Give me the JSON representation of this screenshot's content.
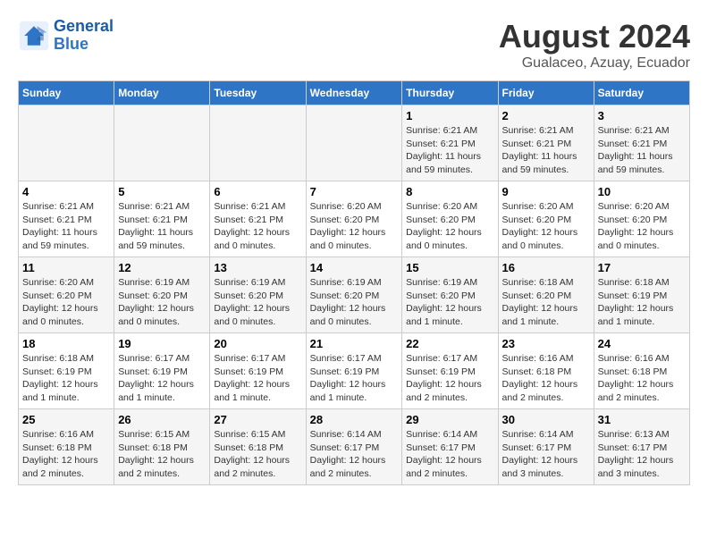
{
  "logo": {
    "line1": "General",
    "line2": "Blue"
  },
  "title": {
    "month_year": "August 2024",
    "location": "Gualaceo, Azuay, Ecuador"
  },
  "weekdays": [
    "Sunday",
    "Monday",
    "Tuesday",
    "Wednesday",
    "Thursday",
    "Friday",
    "Saturday"
  ],
  "weeks": [
    [
      {
        "day": "",
        "sunrise": "",
        "sunset": "",
        "daylight": ""
      },
      {
        "day": "",
        "sunrise": "",
        "sunset": "",
        "daylight": ""
      },
      {
        "day": "",
        "sunrise": "",
        "sunset": "",
        "daylight": ""
      },
      {
        "day": "",
        "sunrise": "",
        "sunset": "",
        "daylight": ""
      },
      {
        "day": "1",
        "sunrise": "Sunrise: 6:21 AM",
        "sunset": "Sunset: 6:21 PM",
        "daylight": "Daylight: 11 hours and 59 minutes."
      },
      {
        "day": "2",
        "sunrise": "Sunrise: 6:21 AM",
        "sunset": "Sunset: 6:21 PM",
        "daylight": "Daylight: 11 hours and 59 minutes."
      },
      {
        "day": "3",
        "sunrise": "Sunrise: 6:21 AM",
        "sunset": "Sunset: 6:21 PM",
        "daylight": "Daylight: 11 hours and 59 minutes."
      }
    ],
    [
      {
        "day": "4",
        "sunrise": "Sunrise: 6:21 AM",
        "sunset": "Sunset: 6:21 PM",
        "daylight": "Daylight: 11 hours and 59 minutes."
      },
      {
        "day": "5",
        "sunrise": "Sunrise: 6:21 AM",
        "sunset": "Sunset: 6:21 PM",
        "daylight": "Daylight: 11 hours and 59 minutes."
      },
      {
        "day": "6",
        "sunrise": "Sunrise: 6:21 AM",
        "sunset": "Sunset: 6:21 PM",
        "daylight": "Daylight: 12 hours and 0 minutes."
      },
      {
        "day": "7",
        "sunrise": "Sunrise: 6:20 AM",
        "sunset": "Sunset: 6:20 PM",
        "daylight": "Daylight: 12 hours and 0 minutes."
      },
      {
        "day": "8",
        "sunrise": "Sunrise: 6:20 AM",
        "sunset": "Sunset: 6:20 PM",
        "daylight": "Daylight: 12 hours and 0 minutes."
      },
      {
        "day": "9",
        "sunrise": "Sunrise: 6:20 AM",
        "sunset": "Sunset: 6:20 PM",
        "daylight": "Daylight: 12 hours and 0 minutes."
      },
      {
        "day": "10",
        "sunrise": "Sunrise: 6:20 AM",
        "sunset": "Sunset: 6:20 PM",
        "daylight": "Daylight: 12 hours and 0 minutes."
      }
    ],
    [
      {
        "day": "11",
        "sunrise": "Sunrise: 6:20 AM",
        "sunset": "Sunset: 6:20 PM",
        "daylight": "Daylight: 12 hours and 0 minutes."
      },
      {
        "day": "12",
        "sunrise": "Sunrise: 6:19 AM",
        "sunset": "Sunset: 6:20 PM",
        "daylight": "Daylight: 12 hours and 0 minutes."
      },
      {
        "day": "13",
        "sunrise": "Sunrise: 6:19 AM",
        "sunset": "Sunset: 6:20 PM",
        "daylight": "Daylight: 12 hours and 0 minutes."
      },
      {
        "day": "14",
        "sunrise": "Sunrise: 6:19 AM",
        "sunset": "Sunset: 6:20 PM",
        "daylight": "Daylight: 12 hours and 0 minutes."
      },
      {
        "day": "15",
        "sunrise": "Sunrise: 6:19 AM",
        "sunset": "Sunset: 6:20 PM",
        "daylight": "Daylight: 12 hours and 1 minute."
      },
      {
        "day": "16",
        "sunrise": "Sunrise: 6:18 AM",
        "sunset": "Sunset: 6:20 PM",
        "daylight": "Daylight: 12 hours and 1 minute."
      },
      {
        "day": "17",
        "sunrise": "Sunrise: 6:18 AM",
        "sunset": "Sunset: 6:19 PM",
        "daylight": "Daylight: 12 hours and 1 minute."
      }
    ],
    [
      {
        "day": "18",
        "sunrise": "Sunrise: 6:18 AM",
        "sunset": "Sunset: 6:19 PM",
        "daylight": "Daylight: 12 hours and 1 minute."
      },
      {
        "day": "19",
        "sunrise": "Sunrise: 6:17 AM",
        "sunset": "Sunset: 6:19 PM",
        "daylight": "Daylight: 12 hours and 1 minute."
      },
      {
        "day": "20",
        "sunrise": "Sunrise: 6:17 AM",
        "sunset": "Sunset: 6:19 PM",
        "daylight": "Daylight: 12 hours and 1 minute."
      },
      {
        "day": "21",
        "sunrise": "Sunrise: 6:17 AM",
        "sunset": "Sunset: 6:19 PM",
        "daylight": "Daylight: 12 hours and 1 minute."
      },
      {
        "day": "22",
        "sunrise": "Sunrise: 6:17 AM",
        "sunset": "Sunset: 6:19 PM",
        "daylight": "Daylight: 12 hours and 2 minutes."
      },
      {
        "day": "23",
        "sunrise": "Sunrise: 6:16 AM",
        "sunset": "Sunset: 6:18 PM",
        "daylight": "Daylight: 12 hours and 2 minutes."
      },
      {
        "day": "24",
        "sunrise": "Sunrise: 6:16 AM",
        "sunset": "Sunset: 6:18 PM",
        "daylight": "Daylight: 12 hours and 2 minutes."
      }
    ],
    [
      {
        "day": "25",
        "sunrise": "Sunrise: 6:16 AM",
        "sunset": "Sunset: 6:18 PM",
        "daylight": "Daylight: 12 hours and 2 minutes."
      },
      {
        "day": "26",
        "sunrise": "Sunrise: 6:15 AM",
        "sunset": "Sunset: 6:18 PM",
        "daylight": "Daylight: 12 hours and 2 minutes."
      },
      {
        "day": "27",
        "sunrise": "Sunrise: 6:15 AM",
        "sunset": "Sunset: 6:18 PM",
        "daylight": "Daylight: 12 hours and 2 minutes."
      },
      {
        "day": "28",
        "sunrise": "Sunrise: 6:14 AM",
        "sunset": "Sunset: 6:17 PM",
        "daylight": "Daylight: 12 hours and 2 minutes."
      },
      {
        "day": "29",
        "sunrise": "Sunrise: 6:14 AM",
        "sunset": "Sunset: 6:17 PM",
        "daylight": "Daylight: 12 hours and 2 minutes."
      },
      {
        "day": "30",
        "sunrise": "Sunrise: 6:14 AM",
        "sunset": "Sunset: 6:17 PM",
        "daylight": "Daylight: 12 hours and 3 minutes."
      },
      {
        "day": "31",
        "sunrise": "Sunrise: 6:13 AM",
        "sunset": "Sunset: 6:17 PM",
        "daylight": "Daylight: 12 hours and 3 minutes."
      }
    ]
  ]
}
